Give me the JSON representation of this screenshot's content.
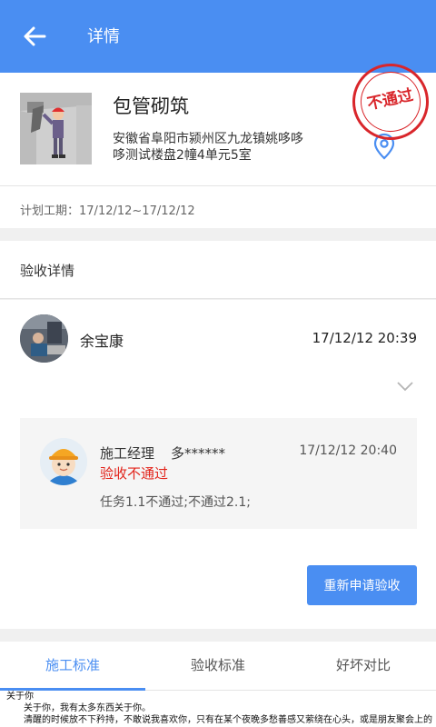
{
  "header": {
    "title": "详情"
  },
  "project": {
    "title": "包管砌筑",
    "address": "安徽省阜阳市颍州区九龙镇姚哆哆哆测试楼盘2幢4单元5室",
    "stamp": "不通过"
  },
  "plan": {
    "label": "计划工期：",
    "value": "17/12/12~17/12/12"
  },
  "section": {
    "title": "验收详情"
  },
  "record": {
    "name": "余宝康",
    "time": "17/12/12 20:39",
    "review": {
      "role": "施工经理",
      "user": "多******",
      "time": "17/12/12 20:40",
      "status": "验收不通过",
      "detail": "任务1.1不通过;不通过2.1;"
    },
    "reapply_label": "重新申请验收"
  },
  "tabs": [
    {
      "label": "施工标准",
      "active": true
    },
    {
      "label": "验收标准",
      "active": false
    },
    {
      "label": "好坏对比",
      "active": false
    }
  ],
  "document": {
    "line1": "关于你",
    "line2": "关于你，我有太多东西关于你。",
    "line3": "清醒的时候放不下矜持，不敢说我喜欢你，只有在某个夜晚多愁善感又萦绕在心头，或是朋友聚会上的"
  },
  "colors": {
    "primary": "#4a8ef2",
    "error": "#e2231a",
    "stamp": "#d9262b"
  }
}
